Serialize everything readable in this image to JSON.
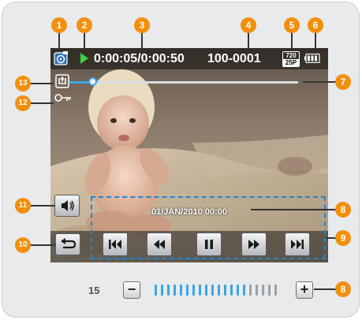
{
  "status": {
    "play_state": "play",
    "time_display": "0:00:05/0:00:50",
    "file_number": "100-0001",
    "format_top": "720",
    "format_bottom": "25P",
    "battery": "full"
  },
  "playback": {
    "position_fraction": 0.1
  },
  "date_stamp": "01/JAN/2010 00:00",
  "controls": [
    {
      "name": "skip-previous-button",
      "icon": "skip-previous-icon"
    },
    {
      "name": "rewind-button",
      "icon": "rewind-icon"
    },
    {
      "name": "pause-button",
      "icon": "pause-icon"
    },
    {
      "name": "fast-forward-button",
      "icon": "fast-forward-icon"
    },
    {
      "name": "skip-next-button",
      "icon": "skip-next-icon"
    }
  ],
  "side_icons": [
    "share-icon",
    "protect-key-icon",
    "volume-icon",
    "back-icon"
  ],
  "volume": {
    "level": "15",
    "max": 20,
    "minus_label": "−",
    "plus_label": "+"
  },
  "callouts": [
    "1",
    "2",
    "3",
    "4",
    "5",
    "6",
    "7",
    "8",
    "9",
    "10",
    "11",
    "12",
    "13",
    "8"
  ],
  "colors": {
    "accent": "#3da4e6",
    "callout": "#f2900e",
    "play": "#3dd23d",
    "dash": "#1f86d6"
  }
}
